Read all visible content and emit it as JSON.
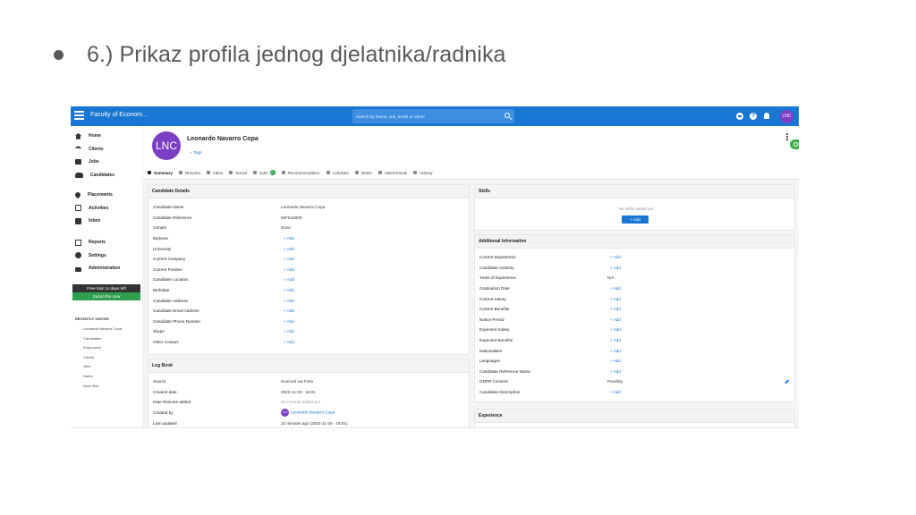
{
  "slide": {
    "bullet": "●",
    "title": "6.) Prikaz profila jednog djelatnika/radnika"
  },
  "topbar": {
    "app_name": "Faculty of Econom...",
    "search_placeholder": "Search by Name, Job, Email or Client",
    "avatar_initials": "LNC",
    "icons": [
      "menu-icon",
      "search-icon",
      "minus-circle-icon",
      "help-icon",
      "bell-icon"
    ]
  },
  "sidebar": {
    "groups": [
      [
        {
          "label": "Home",
          "icon": "home-icon"
        },
        {
          "label": "Clients",
          "icon": "bank-icon"
        },
        {
          "label": "Jobs",
          "icon": "briefcase-icon"
        },
        {
          "label": "Candidates",
          "icon": "people-icon"
        }
      ],
      [
        {
          "label": "Placements",
          "icon": "placement-icon"
        },
        {
          "label": "Activities",
          "icon": "calendar-icon"
        },
        {
          "label": "Inbox",
          "icon": "inbox-icon"
        }
      ],
      [
        {
          "label": "Reports",
          "icon": "reports-icon"
        },
        {
          "label": "Settings",
          "icon": "gear-icon"
        },
        {
          "label": "Administration",
          "icon": "lock-icon"
        }
      ]
    ],
    "trial_text": "Free trial 14 days left",
    "subscribe_label": "Subscribe now",
    "recent_title": "RECENTLY VISITED",
    "recent": [
      "Leonardo Navarro Copa",
      "Candidates",
      "Employees",
      "Clients",
      "Jobs",
      "Home",
      "Novo Bob"
    ]
  },
  "profile": {
    "initials": "LNC",
    "name": "Leonardo Navarro Copa",
    "tags_label": "+ Tags"
  },
  "tabs": [
    {
      "label": "Summary",
      "active": true
    },
    {
      "label": "Resume"
    },
    {
      "label": "Inbox"
    },
    {
      "label": "Social"
    },
    {
      "label": "Jobs",
      "badge": "0"
    },
    {
      "label": "Recommendation"
    },
    {
      "label": "Activities"
    },
    {
      "label": "Notes"
    },
    {
      "label": "Attachments"
    },
    {
      "label": "History"
    }
  ],
  "candidate_details": {
    "title": "Candidate Details",
    "rows": [
      {
        "label": "Candidate Name",
        "value": "Leonardo Navarro Copa"
      },
      {
        "label": "Candidate Reference",
        "value": "62F544809"
      },
      {
        "label": "Gender",
        "value": "None"
      },
      {
        "label": "Diploma",
        "value": "+ Add",
        "kind": "add"
      },
      {
        "label": "University",
        "value": "+ Add",
        "kind": "add"
      },
      {
        "label": "Current Company",
        "value": "+ Add",
        "kind": "add"
      },
      {
        "label": "Current Position",
        "value": "+ Add",
        "kind": "add"
      },
      {
        "label": "Candidate Location",
        "value": "+ Add",
        "kind": "add"
      },
      {
        "label": "Birthdate",
        "value": "+ Add",
        "kind": "add"
      },
      {
        "label": "Candidate Address",
        "value": "+ Add",
        "kind": "add"
      },
      {
        "label": "Candidate Email Address",
        "value": "+ Add",
        "kind": "add"
      },
      {
        "label": "Candidate Phone Number",
        "value": "+ Add",
        "kind": "add"
      },
      {
        "label": "Skype",
        "value": "+ Add",
        "kind": "add"
      },
      {
        "label": "Other Contact",
        "value": "+ Add",
        "kind": "add"
      }
    ]
  },
  "log_book": {
    "title": "Log Book",
    "rows": [
      {
        "label": "Source",
        "value": "Sourced via Form"
      },
      {
        "label": "Created date",
        "value": "2023-11-25 - 16:01"
      },
      {
        "label": "Date Resume added",
        "value": "No resume added yet",
        "kind": "muted"
      },
      {
        "label": "Created by",
        "value": "Leonardo Navarro Copa",
        "kind": "link",
        "avatar": "LNC"
      },
      {
        "label": "Last updated",
        "value": "22 minutes ago (2023-11-25 - 16:01)"
      }
    ]
  },
  "skills": {
    "title": "Skills",
    "empty_text": "No skills added yet",
    "add_label": "+ Add"
  },
  "additional_info": {
    "title": "Additional Information",
    "rows": [
      {
        "label": "Current Department",
        "value": "+ Add",
        "kind": "add"
      },
      {
        "label": "Candidate Industry",
        "value": "+ Add",
        "kind": "add"
      },
      {
        "label": "Years of Experience",
        "value": "N/A"
      },
      {
        "label": "Graduation Date",
        "value": "+ Add",
        "kind": "add"
      },
      {
        "label": "Current Salary",
        "value": "+ Add",
        "kind": "add"
      },
      {
        "label": "Current Benefits",
        "value": "+ Add",
        "kind": "add"
      },
      {
        "label": "Notice Period",
        "value": "+ Add",
        "kind": "add"
      },
      {
        "label": "Expected Salary",
        "value": "+ Add",
        "kind": "add"
      },
      {
        "label": "Expected Benefits",
        "value": "+ Add",
        "kind": "add"
      },
      {
        "label": "Nationalities",
        "value": "+ Add",
        "kind": "add"
      },
      {
        "label": "Languages",
        "value": "+ Add",
        "kind": "add"
      },
      {
        "label": "Candidate Reference Name",
        "value": "+ Add",
        "kind": "add"
      },
      {
        "label": "GDPR Consent",
        "value": "Pending",
        "edit": true
      },
      {
        "label": "Candidate Description",
        "value": "+ Add",
        "kind": "add"
      }
    ]
  },
  "experience": {
    "title": "Experience"
  },
  "colors": {
    "primary": "#1976d2",
    "avatar": "#7b3fc4",
    "success": "#2e9e4f"
  }
}
